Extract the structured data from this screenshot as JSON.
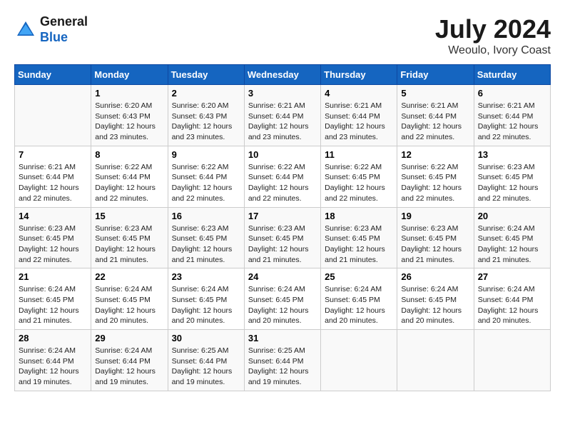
{
  "header": {
    "logo_general": "General",
    "logo_blue": "Blue",
    "month_year": "July 2024",
    "location": "Weoulo, Ivory Coast"
  },
  "days_of_week": [
    "Sunday",
    "Monday",
    "Tuesday",
    "Wednesday",
    "Thursday",
    "Friday",
    "Saturday"
  ],
  "weeks": [
    [
      {
        "day": "",
        "detail": ""
      },
      {
        "day": "1",
        "detail": "Sunrise: 6:20 AM\nSunset: 6:43 PM\nDaylight: 12 hours\nand 23 minutes."
      },
      {
        "day": "2",
        "detail": "Sunrise: 6:20 AM\nSunset: 6:43 PM\nDaylight: 12 hours\nand 23 minutes."
      },
      {
        "day": "3",
        "detail": "Sunrise: 6:21 AM\nSunset: 6:44 PM\nDaylight: 12 hours\nand 23 minutes."
      },
      {
        "day": "4",
        "detail": "Sunrise: 6:21 AM\nSunset: 6:44 PM\nDaylight: 12 hours\nand 23 minutes."
      },
      {
        "day": "5",
        "detail": "Sunrise: 6:21 AM\nSunset: 6:44 PM\nDaylight: 12 hours\nand 22 minutes."
      },
      {
        "day": "6",
        "detail": "Sunrise: 6:21 AM\nSunset: 6:44 PM\nDaylight: 12 hours\nand 22 minutes."
      }
    ],
    [
      {
        "day": "7",
        "detail": "Sunrise: 6:21 AM\nSunset: 6:44 PM\nDaylight: 12 hours\nand 22 minutes."
      },
      {
        "day": "8",
        "detail": "Sunrise: 6:22 AM\nSunset: 6:44 PM\nDaylight: 12 hours\nand 22 minutes."
      },
      {
        "day": "9",
        "detail": "Sunrise: 6:22 AM\nSunset: 6:44 PM\nDaylight: 12 hours\nand 22 minutes."
      },
      {
        "day": "10",
        "detail": "Sunrise: 6:22 AM\nSunset: 6:44 PM\nDaylight: 12 hours\nand 22 minutes."
      },
      {
        "day": "11",
        "detail": "Sunrise: 6:22 AM\nSunset: 6:45 PM\nDaylight: 12 hours\nand 22 minutes."
      },
      {
        "day": "12",
        "detail": "Sunrise: 6:22 AM\nSunset: 6:45 PM\nDaylight: 12 hours\nand 22 minutes."
      },
      {
        "day": "13",
        "detail": "Sunrise: 6:23 AM\nSunset: 6:45 PM\nDaylight: 12 hours\nand 22 minutes."
      }
    ],
    [
      {
        "day": "14",
        "detail": "Sunrise: 6:23 AM\nSunset: 6:45 PM\nDaylight: 12 hours\nand 22 minutes."
      },
      {
        "day": "15",
        "detail": "Sunrise: 6:23 AM\nSunset: 6:45 PM\nDaylight: 12 hours\nand 21 minutes."
      },
      {
        "day": "16",
        "detail": "Sunrise: 6:23 AM\nSunset: 6:45 PM\nDaylight: 12 hours\nand 21 minutes."
      },
      {
        "day": "17",
        "detail": "Sunrise: 6:23 AM\nSunset: 6:45 PM\nDaylight: 12 hours\nand 21 minutes."
      },
      {
        "day": "18",
        "detail": "Sunrise: 6:23 AM\nSunset: 6:45 PM\nDaylight: 12 hours\nand 21 minutes."
      },
      {
        "day": "19",
        "detail": "Sunrise: 6:23 AM\nSunset: 6:45 PM\nDaylight: 12 hours\nand 21 minutes."
      },
      {
        "day": "20",
        "detail": "Sunrise: 6:24 AM\nSunset: 6:45 PM\nDaylight: 12 hours\nand 21 minutes."
      }
    ],
    [
      {
        "day": "21",
        "detail": "Sunrise: 6:24 AM\nSunset: 6:45 PM\nDaylight: 12 hours\nand 21 minutes."
      },
      {
        "day": "22",
        "detail": "Sunrise: 6:24 AM\nSunset: 6:45 PM\nDaylight: 12 hours\nand 20 minutes."
      },
      {
        "day": "23",
        "detail": "Sunrise: 6:24 AM\nSunset: 6:45 PM\nDaylight: 12 hours\nand 20 minutes."
      },
      {
        "day": "24",
        "detail": "Sunrise: 6:24 AM\nSunset: 6:45 PM\nDaylight: 12 hours\nand 20 minutes."
      },
      {
        "day": "25",
        "detail": "Sunrise: 6:24 AM\nSunset: 6:45 PM\nDaylight: 12 hours\nand 20 minutes."
      },
      {
        "day": "26",
        "detail": "Sunrise: 6:24 AM\nSunset: 6:45 PM\nDaylight: 12 hours\nand 20 minutes."
      },
      {
        "day": "27",
        "detail": "Sunrise: 6:24 AM\nSunset: 6:44 PM\nDaylight: 12 hours\nand 20 minutes."
      }
    ],
    [
      {
        "day": "28",
        "detail": "Sunrise: 6:24 AM\nSunset: 6:44 PM\nDaylight: 12 hours\nand 19 minutes."
      },
      {
        "day": "29",
        "detail": "Sunrise: 6:24 AM\nSunset: 6:44 PM\nDaylight: 12 hours\nand 19 minutes."
      },
      {
        "day": "30",
        "detail": "Sunrise: 6:25 AM\nSunset: 6:44 PM\nDaylight: 12 hours\nand 19 minutes."
      },
      {
        "day": "31",
        "detail": "Sunrise: 6:25 AM\nSunset: 6:44 PM\nDaylight: 12 hours\nand 19 minutes."
      },
      {
        "day": "",
        "detail": ""
      },
      {
        "day": "",
        "detail": ""
      },
      {
        "day": "",
        "detail": ""
      }
    ]
  ]
}
